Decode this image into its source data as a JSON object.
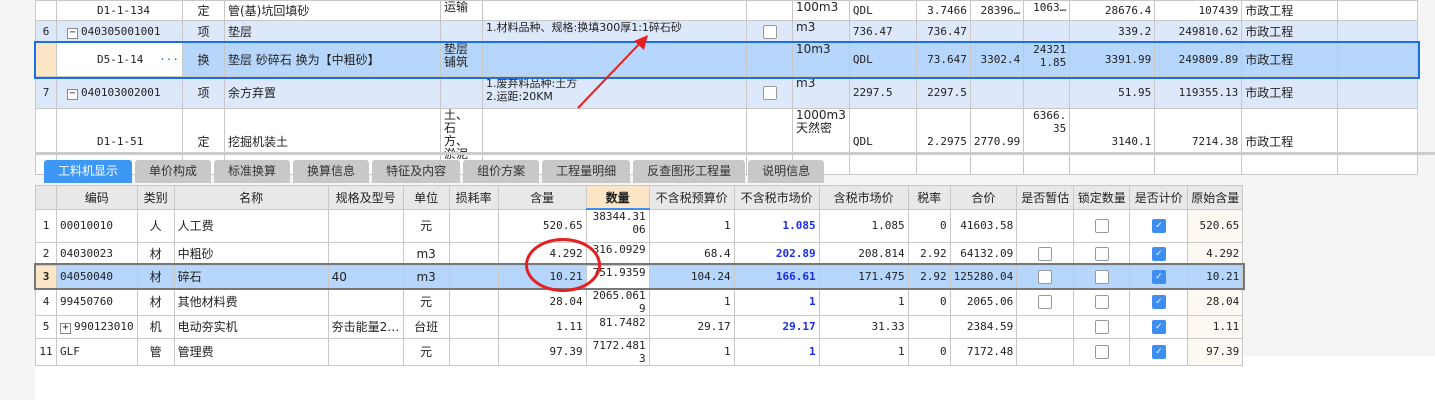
{
  "top_rows": [
    {
      "num": "",
      "code": "D1-1-134",
      "type": "定",
      "name": "管(基)坑回填砂",
      "feature": "运输",
      "desc": "",
      "check": false,
      "unit": "100m3",
      "qdl": "QDL",
      "qty": "3.7466",
      "p1": "28396…",
      "p2": "1063…",
      "price": "28676.4",
      "total": "107439",
      "prof": "市政工程"
    },
    {
      "num": "6",
      "code": "040305001001",
      "type": "项",
      "name": "垫层",
      "feature": "",
      "desc": "1.材料品种、规格:换填300厚1:1碎石砂",
      "check": true,
      "unit": "m3",
      "qdl": "736.47",
      "qty": "736.47",
      "p1": "",
      "p2": "",
      "price": "339.2",
      "total": "249810.62",
      "prof": "市政工程"
    },
    {
      "num": "",
      "code": "D5-1-14",
      "type": "换",
      "name": "垫层 砂碎石  换为【中粗砂】",
      "feature": "垫层铺筑",
      "desc": "",
      "check": false,
      "unit": "10m3",
      "qdl": "QDL",
      "qty": "73.647",
      "p1": "3302.4",
      "p2": "243211.85",
      "price": "3391.99",
      "total": "249809.89",
      "prof": "市政工程"
    },
    {
      "num": "7",
      "code": "040103002001",
      "type": "项",
      "name": "余方弃置",
      "feature": "",
      "desc": "1.废弃料品种:土方\n2.运距:20KM",
      "check": true,
      "unit": "m3",
      "qdl": "2297.5",
      "qty": "2297.5",
      "p1": "",
      "p2": "",
      "price": "51.95",
      "total": "119355.13",
      "prof": "市政工程"
    },
    {
      "num": "",
      "code": "D1-1-51",
      "type": "定",
      "name": "挖掘机装土",
      "feature": "土、石方、淤泥(流",
      "desc": "",
      "check": false,
      "unit": "1000m3天然密",
      "qdl": "QDL",
      "qty": "2.2975",
      "p1": "2770.99",
      "p2": "6366.35",
      "price": "3140.1",
      "total": "7214.38",
      "prof": "市政工程"
    }
  ],
  "tabs": [
    "工料机显示",
    "单价构成",
    "标准换算",
    "换算信息",
    "特征及内容",
    "组价方案",
    "工程量明细",
    "反查图形工程量",
    "说明信息"
  ],
  "headers": [
    "",
    "编码",
    "类别",
    "名称",
    "规格及型号",
    "单位",
    "损耗率",
    "含量",
    "数量",
    "不含税预算价",
    "不含税市场价",
    "含税市场价",
    "税率",
    "合价",
    "是否暂估",
    "锁定数量",
    "是否计价",
    "原始含量"
  ],
  "rows": [
    {
      "n": "1",
      "code": "00010010",
      "type": "人",
      "name": "人工费",
      "spec": "",
      "unit": "元",
      "loss": "",
      "content": "520.65",
      "qty": "38344.3106",
      "budget": "1",
      "market": "1.085",
      "taxm": "1.085",
      "rate": "0",
      "total": "41603.58",
      "est": null,
      "lock": false,
      "calc": true,
      "orig": "520.65"
    },
    {
      "n": "2",
      "code": "04030023",
      "type": "材",
      "name": "中粗砂",
      "spec": "",
      "unit": "m3",
      "loss": "",
      "content": "4.292",
      "qty": "316.0929",
      "budget": "68.4",
      "market": "202.89",
      "taxm": "208.814",
      "rate": "2.92",
      "total": "64132.09",
      "est": false,
      "lock": false,
      "calc": true,
      "orig": "4.292"
    },
    {
      "n": "3",
      "code": "04050040",
      "type": "材",
      "name": "碎石",
      "spec": "40",
      "unit": "m3",
      "loss": "",
      "content": "10.21",
      "qty": "751.9359",
      "budget": "104.24",
      "market": "166.61",
      "taxm": "171.475",
      "rate": "2.92",
      "total": "125280.04",
      "est": false,
      "lock": false,
      "calc": true,
      "orig": "10.21"
    },
    {
      "n": "4",
      "code": "99450760",
      "type": "材",
      "name": "其他材料费",
      "spec": "",
      "unit": "元",
      "loss": "",
      "content": "28.04",
      "qty": "2065.0619",
      "budget": "1",
      "market": "1",
      "taxm": "1",
      "rate": "0",
      "total": "2065.06",
      "est": false,
      "lock": false,
      "calc": true,
      "orig": "28.04"
    },
    {
      "n": "5",
      "code": "990123010",
      "type": "机",
      "name": "电动夯实机",
      "spec": "夯击能量2…",
      "unit": "台班",
      "loss": "",
      "content": "1.11",
      "qty": "81.7482",
      "budget": "29.17",
      "market": "29.17",
      "taxm": "31.33",
      "rate": "",
      "total": "2384.59",
      "est": null,
      "lock": false,
      "calc": true,
      "orig": "1.11"
    },
    {
      "n": "11",
      "code": "GLF",
      "type": "管",
      "name": "管理费",
      "spec": "",
      "unit": "元",
      "loss": "",
      "content": "97.39",
      "qty": "7172.4813",
      "budget": "1",
      "market": "1",
      "taxm": "1",
      "rate": "0",
      "total": "7172.48",
      "est": null,
      "lock": false,
      "calc": true,
      "orig": "97.39"
    }
  ],
  "colors": {
    "accent": "#3d97f5",
    "selection": "#b6d6fb",
    "annotation": "#e62020"
  }
}
